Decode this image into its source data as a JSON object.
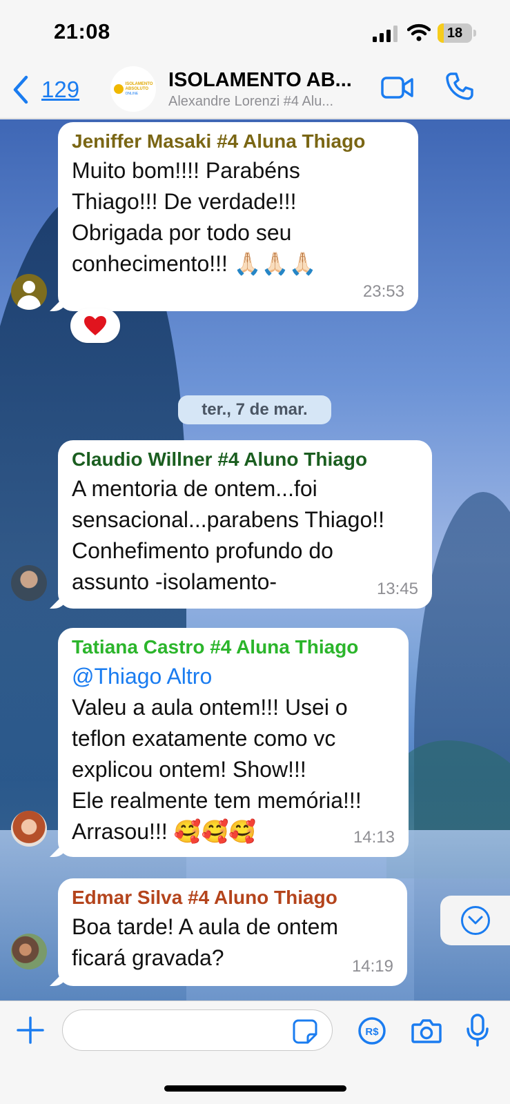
{
  "status_bar": {
    "time": "21:08",
    "battery": "18",
    "battery_level": 0.18
  },
  "header": {
    "back_count": "129",
    "title": "ISOLAMENTO AB...",
    "subtitle": "Alexandre Lorenzi #4 Alu...",
    "avatar_logo": {
      "line1": "ISOLAMENTO",
      "line2": "ABSOLUTO",
      "line3": "ONLINE"
    }
  },
  "messages": [
    {
      "sender": "Jeniffer Masaki #4 Aluna Thiago",
      "sender_color": "#7a6614",
      "lines": [
        "Muito bom!!!! Parabéns",
        "Thiago!!! De verdade!!!",
        "Obrigada por todo seu",
        "conhecimento!!! 🙏🏻🙏🏻🙏🏻"
      ],
      "time": "23:53",
      "reaction": "heart"
    },
    {
      "sender": "Claudio Willner #4 Aluno Thiago",
      "sender_color": "#1b5e20",
      "lines": [
        "A mentoria de ontem...foi",
        "sensacional...parabens Thiago!!",
        "Conhefimento profundo do",
        "assunto -isolamento-"
      ],
      "time": "13:45"
    },
    {
      "sender": "Tatiana Castro #4 Aluna Thiago",
      "sender_color": "#2bb52b",
      "mention": "@Thiago Altro",
      "lines": [
        "Valeu a aula ontem!!! Usei o",
        "teflon exatamente como vc",
        "explicou ontem! Show!!!",
        "Ele realmente tem memória!!!",
        "Arrasou!!! 🥰🥰🥰"
      ],
      "time": "14:13"
    },
    {
      "sender": "Edmar Silva #4 Aluno Thiago",
      "sender_color": "#b4441c",
      "lines": [
        "Boa tarde! A aula de ontem",
        "ficará gravada?"
      ],
      "time": "14:19"
    }
  ],
  "date_separator": "ter., 7 de mar.",
  "colors": {
    "accent": "#1a7cf0",
    "bubble": "#ffffff",
    "date_chip": "#d6e6f6"
  }
}
